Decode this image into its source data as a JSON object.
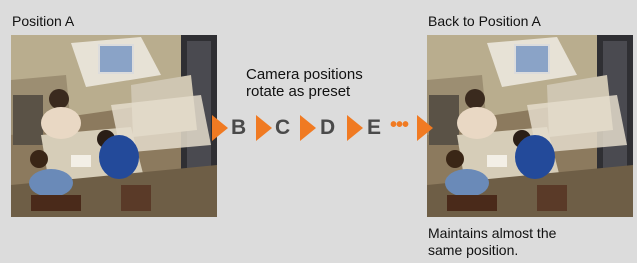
{
  "left_label": "Position A",
  "right_label": "Back to Position A",
  "middle_caption": [
    "Camera positions",
    "rotate as preset"
  ],
  "sequence": {
    "letters": [
      "B",
      "C",
      "D",
      "E"
    ],
    "continuation": "•••"
  },
  "bottom_caption": [
    "Maintains almost the",
    "same position."
  ],
  "colors": {
    "accent": "#f07a22",
    "background": "#dcdcdc",
    "letter": "#4a4a4a"
  }
}
